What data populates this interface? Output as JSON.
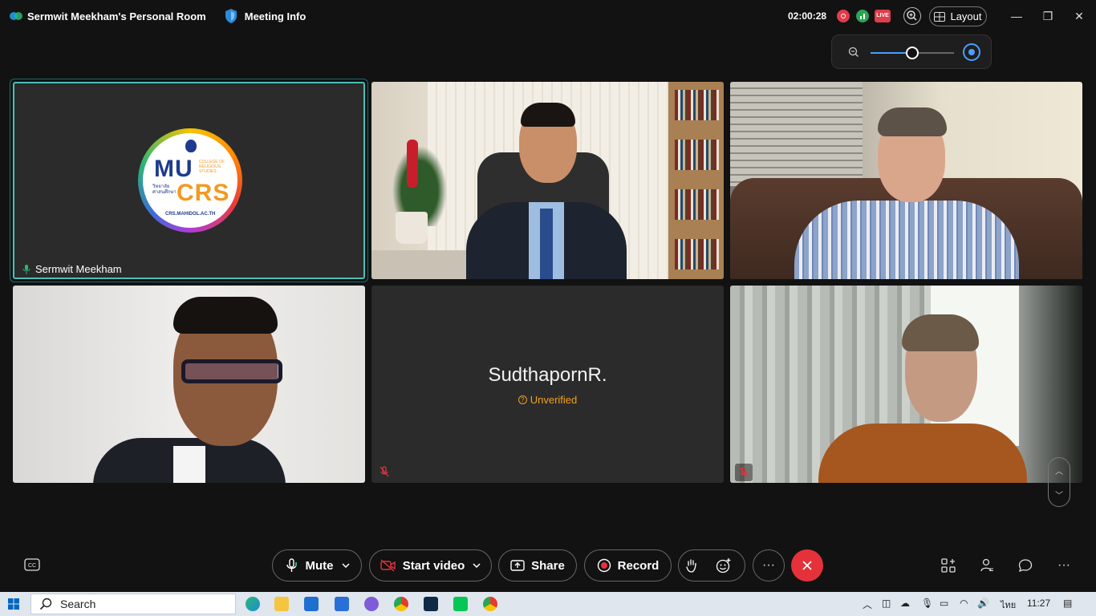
{
  "window": {
    "room_title": "Sermwit Meekham's Personal Room",
    "meeting_info_label": "Meeting Info",
    "timer": "02:00:28",
    "live_badge": "LIVE",
    "layout_label": "Layout",
    "minimize": "—",
    "restore": "❐",
    "close": "✕"
  },
  "zoom": {
    "level_fraction": 0.5
  },
  "tiles": [
    {
      "name": "Sermwit Meekham",
      "logo": {
        "top": "MU",
        "bottom": "CRS",
        "side_text": "COLLEGE OF RELIGIOUS STUDIES",
        "thai": "วิทยาลัยศาสนศึกษา",
        "url": "CRS.MAHIDOL.AC.TH"
      }
    },
    {
      "name": ""
    },
    {
      "name": ""
    },
    {
      "name": ""
    },
    {
      "name": "SudthapornR.",
      "status": "Unverified",
      "status_icon": "?"
    },
    {
      "name": ""
    }
  ],
  "controls": {
    "mute_label": "Mute",
    "start_video_label": "Start video",
    "share_label": "Share",
    "record_label": "Record",
    "more_label": "···",
    "right_more": "···",
    "scroll_up": "︿",
    "scroll_down": "﹀"
  },
  "taskbar": {
    "search_placeholder": "Search",
    "language": "ไทย",
    "clock": "11:27"
  },
  "colors": {
    "active_speaker_border": "#47c1b8",
    "end_button": "#e5323a",
    "recording": "#e03c4a",
    "unverified": "#f0a11e",
    "accent": "#4a9eff"
  }
}
